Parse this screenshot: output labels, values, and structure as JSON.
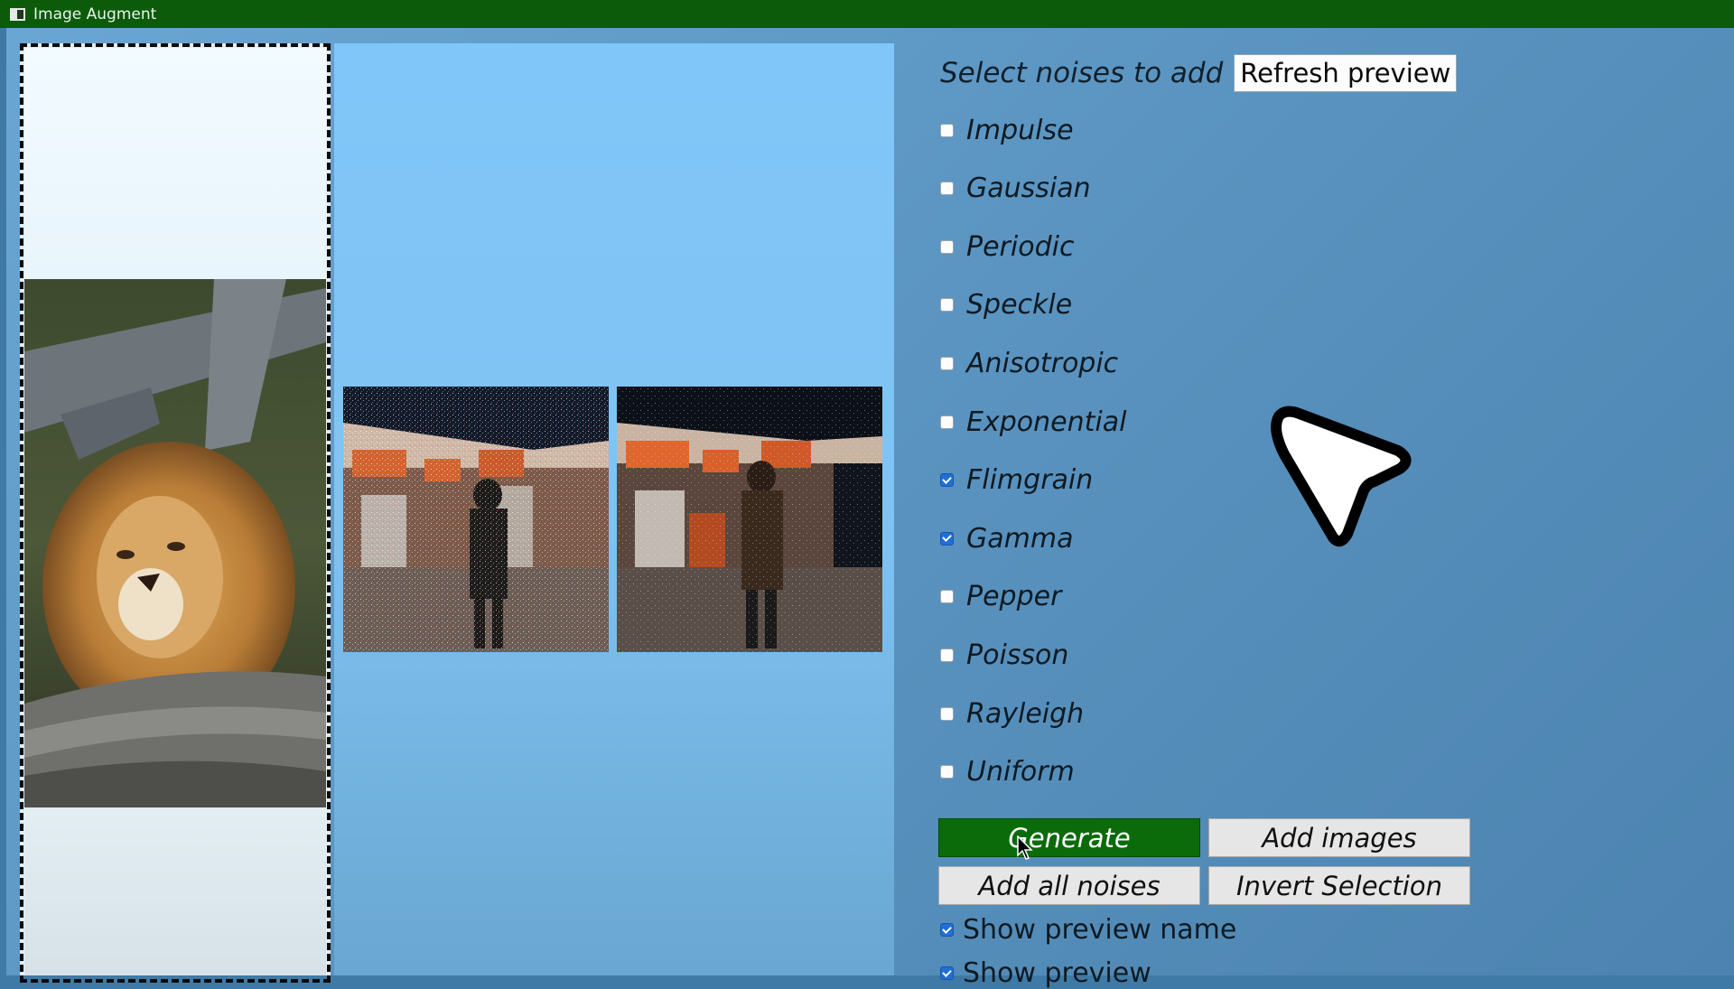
{
  "window": {
    "title": "Image Augment"
  },
  "panel": {
    "heading": "Select noises to add",
    "refresh_label": "Refresh preview"
  },
  "noises": [
    {
      "label": "Impulse",
      "checked": false
    },
    {
      "label": "Gaussian",
      "checked": false
    },
    {
      "label": "Periodic",
      "checked": false
    },
    {
      "label": "Speckle",
      "checked": false
    },
    {
      "label": "Anisotropic",
      "checked": false
    },
    {
      "label": "Exponential",
      "checked": false
    },
    {
      "label": "Flimgrain",
      "checked": true
    },
    {
      "label": "Gamma",
      "checked": true
    },
    {
      "label": "Pepper",
      "checked": false
    },
    {
      "label": "Poisson",
      "checked": false
    },
    {
      "label": "Rayleigh",
      "checked": false
    },
    {
      "label": "Uniform",
      "checked": false
    }
  ],
  "buttons": {
    "generate": "Generate",
    "add_images": "Add images",
    "add_all_noises": "Add all noises",
    "invert_selection": "Invert Selection"
  },
  "options": [
    {
      "label": "Show preview name",
      "checked": true
    },
    {
      "label": "Show preview",
      "checked": true
    }
  ],
  "colors": {
    "titlebar": "#0b5b0b",
    "generate_button": "#0b6b0b",
    "checkbox_checked": "#1f6fd6"
  }
}
